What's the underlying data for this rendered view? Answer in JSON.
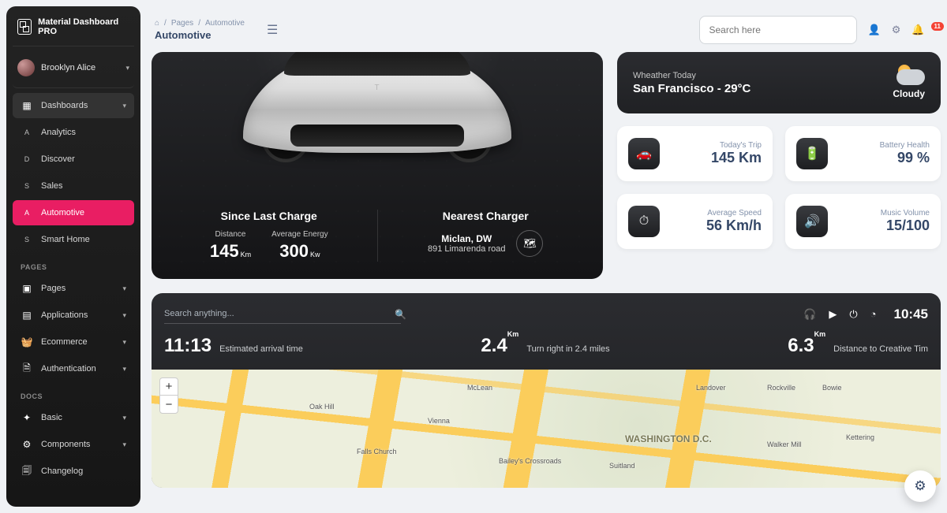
{
  "brand": "Material Dashboard PRO",
  "user": {
    "name": "Brooklyn Alice"
  },
  "nav": {
    "main": {
      "label": "Dashboards"
    },
    "sub": [
      {
        "letter": "A",
        "label": "Analytics"
      },
      {
        "letter": "D",
        "label": "Discover"
      },
      {
        "letter": "S",
        "label": "Sales"
      },
      {
        "letter": "A",
        "label": "Automotive"
      },
      {
        "letter": "S",
        "label": "Smart Home"
      }
    ],
    "pages_title": "PAGES",
    "pages": [
      {
        "label": "Pages"
      },
      {
        "label": "Applications"
      },
      {
        "label": "Ecommerce"
      },
      {
        "label": "Authentication"
      }
    ],
    "docs_title": "DOCS",
    "docs": [
      {
        "label": "Basic"
      },
      {
        "label": "Components"
      },
      {
        "label": "Changelog"
      }
    ]
  },
  "breadcrumb": {
    "l1": "Pages",
    "l2": "Automotive",
    "title": "Automotive"
  },
  "search": {
    "placeholder": "Search here"
  },
  "notifications": {
    "count": "11"
  },
  "car": {
    "since": "Since Last Charge",
    "distance_label": "Distance",
    "distance_val": "145",
    "distance_unit": "Km",
    "energy_label": "Average Energy",
    "energy_val": "300",
    "energy_unit": "Kw",
    "nearest": "Nearest Charger",
    "loc1": "Miclan, DW",
    "loc2": "891 Limarenda road"
  },
  "weather": {
    "label": "Wheather Today",
    "value": "San Francisco - 29°C",
    "desc": "Cloudy"
  },
  "stats": [
    {
      "label": "Today's Trip",
      "value": "145 Km"
    },
    {
      "label": "Battery Health",
      "value": "99 %"
    },
    {
      "label": "Average Speed",
      "value": "56 Km/h"
    },
    {
      "label": "Music Volume",
      "value": "15/100"
    }
  ],
  "navbar": {
    "placeholder": "Search anything...",
    "time": "10:45",
    "eta_val": "11:13",
    "eta_label": "Estimated arrival time",
    "turn_val": "2.4",
    "turn_unit": "Km",
    "turn_label": "Turn right in 2.4 miles",
    "dist_val": "6.3",
    "dist_unit": "Km",
    "dist_label": "Distance to Creative Tim"
  },
  "map": {
    "dc": "WASHINGTON D.C.",
    "labels": [
      "Rockville",
      "Oak Hill",
      "McLean",
      "Falls Church",
      "Vienna",
      "Bailey's Crossroads",
      "Suitland",
      "Landover",
      "Walker Mill",
      "Bowie",
      "Kettering"
    ]
  }
}
